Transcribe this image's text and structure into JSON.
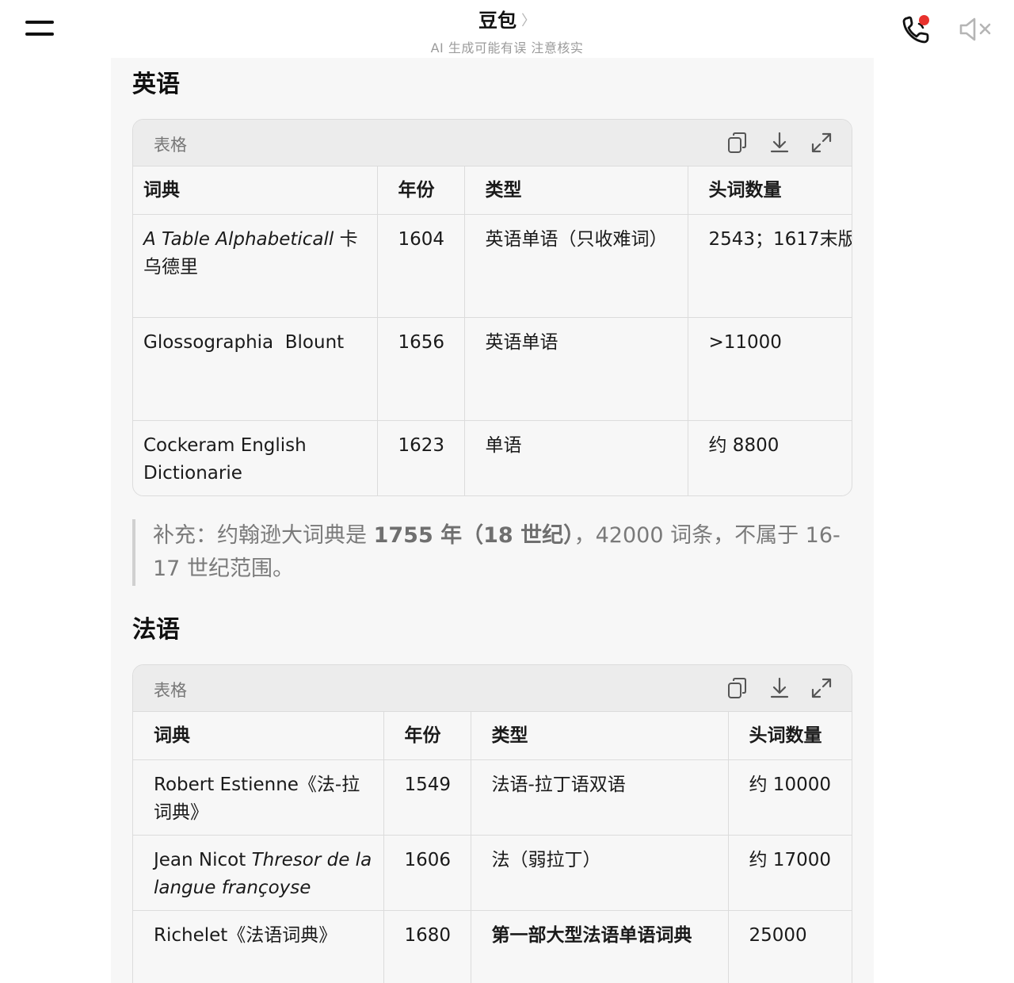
{
  "header": {
    "title": "豆包",
    "title_chevron": "〉",
    "subtitle": "AI 生成可能有误 注意核实"
  },
  "sections": {
    "english": {
      "heading": "英语",
      "table_label": "表格",
      "columns": [
        "词典",
        "年份",
        "类型",
        "头词数量"
      ],
      "rows": [
        {
          "dict_italic": "A Table Alphabeticall",
          "dict_rest": " 卡乌德里",
          "year": "1604",
          "type": "英语单语（只收难词）",
          "count": "2543；1617末版"
        },
        {
          "dict_italic": "",
          "dict_rest": "Glossographia  Blount",
          "year": "1656",
          "type": "英语单语",
          "count": ">11000"
        },
        {
          "dict_italic": "",
          "dict_rest": "Cockeram English Dictionarie",
          "year": "1623",
          "type": "单语",
          "count": "约 8800"
        }
      ]
    },
    "note": {
      "prefix": "补充：约翰逊大词典是 ",
      "bold": "1755 年（18 世纪）",
      "suffix": "，42000 词条，不属于 16-17 世纪范围。"
    },
    "french": {
      "heading": "法语",
      "table_label": "表格",
      "columns": [
        "词典",
        "年份",
        "类型",
        "头词数量"
      ],
      "rows": [
        {
          "dict_pre": "Robert Estienne《法-拉词典》",
          "dict_italic": "",
          "year": "1549",
          "type": "法语-拉丁语双语",
          "type_bold": false,
          "count": "约 10000"
        },
        {
          "dict_pre": "Jean Nicot ",
          "dict_italic": "Thresor de la langue françoyse",
          "year": "1606",
          "type": "法（弱拉丁）",
          "type_bold": false,
          "count": "约 17000"
        },
        {
          "dict_pre": "Richelet《法语词典》",
          "dict_italic": "",
          "year": "1680",
          "type": "第一部大型法语单语词典",
          "type_bold": true,
          "count": "25000"
        }
      ]
    }
  },
  "icons": {
    "menu": "menu-icon",
    "call": "phone-call-icon",
    "mute": "speaker-muted-icon",
    "copy": "copy-icon",
    "download": "download-icon",
    "expand": "expand-icon"
  },
  "colors": {
    "notification_dot": "#e8322d",
    "card_bg": "#f7f7f7",
    "table_header_bg": "#ececec"
  }
}
